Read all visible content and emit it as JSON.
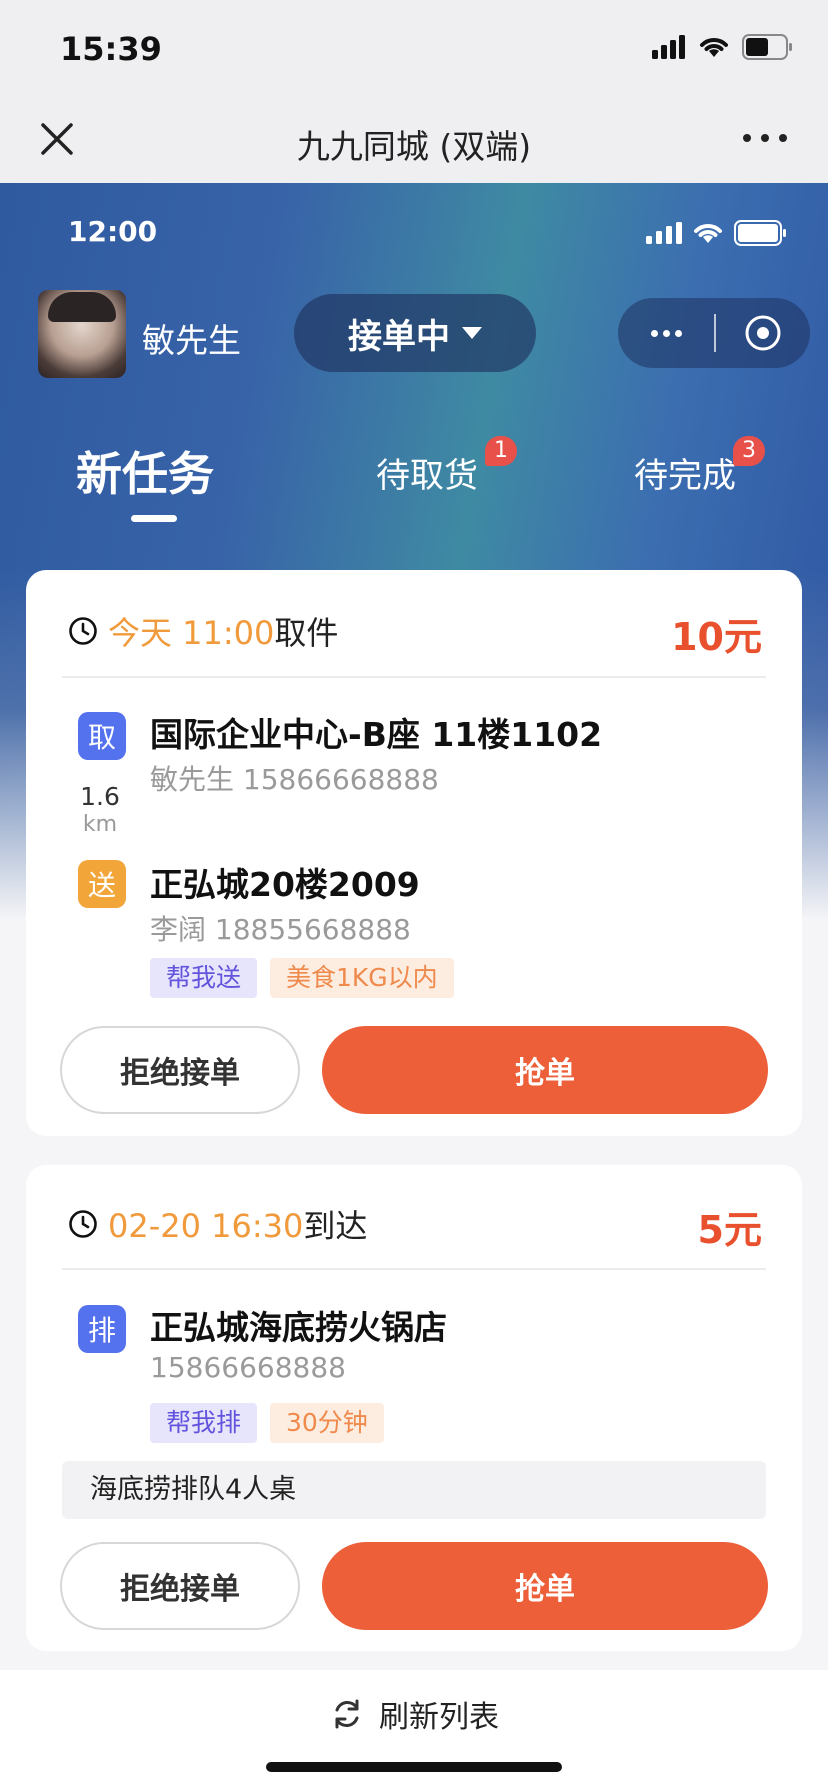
{
  "os_status": {
    "time": "15:39"
  },
  "nav": {
    "title": "九九同城 (双端)"
  },
  "inner_status": {
    "time": "12:00"
  },
  "header": {
    "user_name": "敏先生",
    "status_label": "接单中"
  },
  "tabs": [
    {
      "label": "新任务",
      "badge": ""
    },
    {
      "label": "待取货",
      "badge": "1"
    },
    {
      "label": "待完成",
      "badge": "3"
    }
  ],
  "orders": [
    {
      "time_text": "今天 11:00",
      "time_suffix": "取件",
      "price": "10元",
      "pickup": {
        "icon": "取",
        "address": "国际企业中心-B座 11楼1102",
        "contact": "敏先生 15866668888"
      },
      "distance": {
        "value": "1.6",
        "unit": "km"
      },
      "dropoff": {
        "icon": "送",
        "address": "正弘城20楼2009",
        "contact": "李阔 18855668888"
      },
      "tags": [
        "帮我送",
        "美食1KG以内"
      ],
      "reject_label": "拒绝接单",
      "grab_label": "抢单"
    },
    {
      "time_text": "02-20 16:30",
      "time_suffix": "到达",
      "price": "5元",
      "queue": {
        "icon": "排",
        "address": "正弘城海底捞火锅店",
        "contact": "15866668888"
      },
      "tags": [
        "帮我排",
        "30分钟"
      ],
      "note": "海底捞排队4人桌",
      "reject_label": "拒绝接单",
      "grab_label": "抢单"
    }
  ],
  "refresh_label": "刷新列表",
  "colors": {
    "accent": "#ec5f38",
    "price": "#e9502e",
    "time": "#f09a3c",
    "header_blue": "#2f5aa0"
  }
}
